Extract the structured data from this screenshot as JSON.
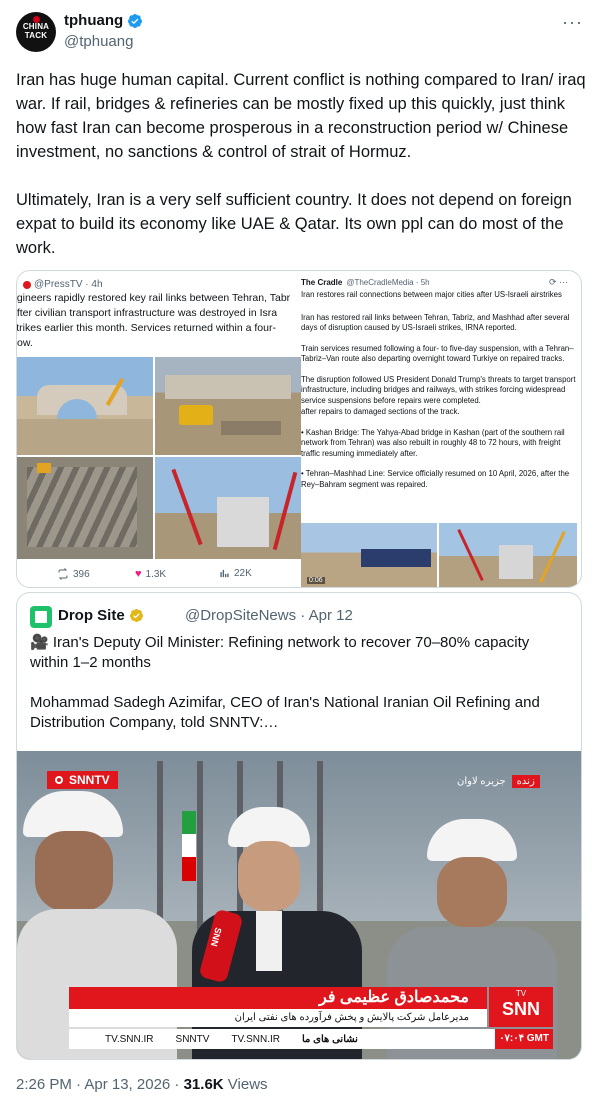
{
  "tweet": {
    "author_name": "tphuang",
    "author_handle": "@tphuang",
    "avatar_text": "CHINA TACK",
    "more_label": "···",
    "paragraph1": "Iran has huge human capital. Current conflict is nothing compared to Iran/ iraq war. If rail, bridges & refineries can be mostly fixed up this quickly, just think how fast Iran can become prosperous in a reconstruction period w/ Chinese investment, no sanctions & control of strait of Hormuz.",
    "paragraph2": "Ultimately, Iran is a very self sufficient country. It does not depend on foreign expat to build its economy like UAE & Qatar. Its own ppl can do most of the work.",
    "timestamp": "2:26 PM · Apr 13, 2026 · ",
    "views_count": "31.6K",
    "views_label": " Views"
  },
  "presstv": {
    "handle": "@PressTV · 4h",
    "line1": "ngineers rapidly restored key rail links between Tehran, Tabr",
    "line2": " after civilian transport infrastructure was destroyed in Isra",
    "line3": " strikes earlier this month. Services returned within a four-",
    "line4": "ow.",
    "retweets": "396",
    "likes": "1.3K",
    "views": "22K"
  },
  "cradle": {
    "name": "The Cradle",
    "handle": "@TheCradleMedia · 5h",
    "title": "Iran restores rail connections between major cities after US-Israeli airstrikes",
    "p1": "Iran has restored rail links between Tehran, Tabriz, and Mashhad after several days of disruption caused by US-Israeli strikes, IRNA reported.",
    "p2": "Train services resumed following a four- to five-day suspension, with a Tehran–Tabriz–Van route also departing overnight toward Turkiye on repaired tracks.",
    "p3": "The disruption followed US President Donald Trump's threats to target transport infrastructure, including bridges and railways, with strikes forcing widespread service suspensions before repairs were completed.",
    "p4": "after repairs to damaged sections of the track.",
    "p5": "• Kashan Bridge: The Yahya-Abad bridge in Kashan (part of the southern rail network from Tehran) was also rebuilt in roughly 48 to 72 hours, with freight traffic resuming immediately after.",
    "p6": "• Tehran–Mashhad Line: Service officially resumed on 10 April, 2026, after the Rey–Bahram segment was repaired.",
    "video_time": "0:06"
  },
  "quote": {
    "name": "Drop Site",
    "handle_date": "@DropSiteNews · Apr 12",
    "headline": "🎥 Iran's Deputy Oil Minister: Refining network to recover 70–80% capacity within 1–2 months",
    "body": "Mohammad Sadegh Azimifar, CEO of Iran's National Iranian Oil Refining and Distribution Company, told SNNTV:…"
  },
  "video": {
    "channel": "SNNTV",
    "live_label": "زنده",
    "location": "جزیره لاوان",
    "guest_name": "محمدصادق عظیمی فر",
    "guest_title": "مدیرعامل شرکت پالایش و پخش فرآورده های نفتی ایران",
    "logo": "SNN",
    "logo_sub": "TV",
    "social1": "TV.SNN.IR",
    "social2": "SNNTV",
    "social3": "TV.SNN.IR",
    "social4": "نشانی های ما",
    "clock": "۰۷:۰۴ GMT",
    "mic_label": "SNN"
  },
  "colors": {
    "verified": "#1d9bf0",
    "gold": "#e2b719",
    "snn_red": "#e0161c",
    "like": "#f91880"
  }
}
